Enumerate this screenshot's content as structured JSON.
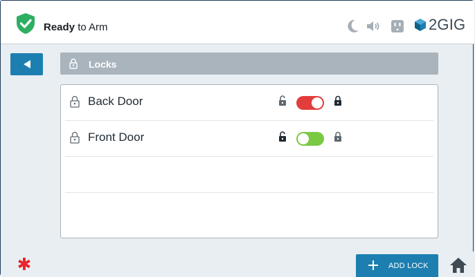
{
  "status": {
    "bold": "Ready",
    "rest": " to Arm",
    "color": "#2eae62"
  },
  "brand": {
    "name": "2GIG"
  },
  "top_icons": [
    "moon-icon",
    "speaker-icon",
    "outlet-icon"
  ],
  "header": {
    "title": "Locks"
  },
  "locks": [
    {
      "name": "Back Door",
      "state": "locked",
      "toggle_color": "#e23d3d"
    },
    {
      "name": "Front Door",
      "state": "unlocked",
      "toggle_color": "#7ac943"
    }
  ],
  "bottom": {
    "add_label": "ADD LOCK"
  },
  "colors": {
    "accent": "#1d7fb0",
    "alert": "#e8262e",
    "header": "#aab4bd"
  }
}
